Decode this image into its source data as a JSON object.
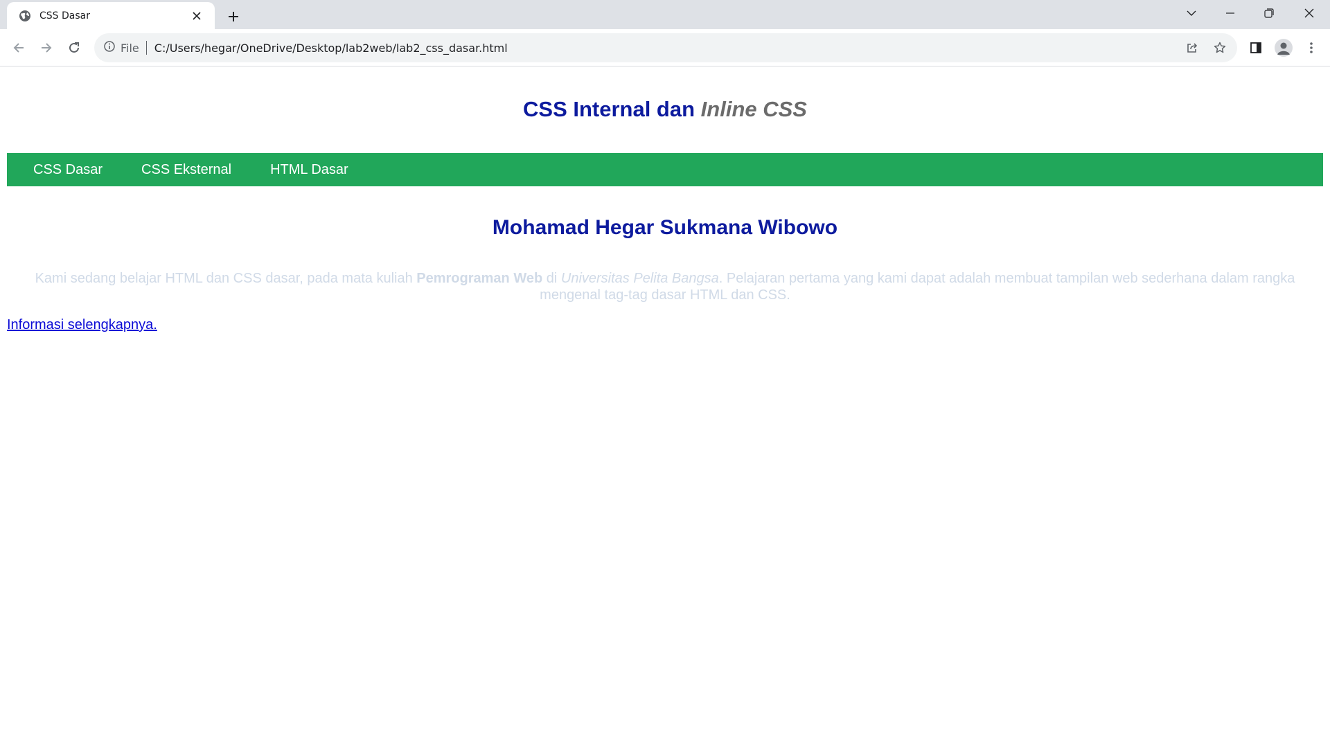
{
  "browser": {
    "tab_title": "CSS Dasar",
    "address_scheme_label": "File",
    "url": "C:/Users/hegar/OneDrive/Desktop/lab2web/lab2_css_dasar.html"
  },
  "page": {
    "title_main": "CSS Internal dan ",
    "title_emphasis": "Inline CSS",
    "nav": [
      {
        "label": "CSS Dasar"
      },
      {
        "label": "CSS Eksternal"
      },
      {
        "label": "HTML Dasar"
      }
    ],
    "author": "Mohamad Hegar Sukmana Wibowo",
    "paragraph": {
      "part1": "Kami sedang belajar HTML dan CSS dasar, pada mata kuliah ",
      "bold": "Pemrograman Web",
      "part2": " di ",
      "italic": "Universitas Pelita Bangsa",
      "part3": ". Pelajaran pertama yang kami dapat adalah membuat tampilan web sederhana dalam rangka mengenal tag-tag dasar HTML dan CSS."
    },
    "more_link": "Informasi selengkapnya."
  },
  "colors": {
    "heading": "#0d1b9e",
    "heading_emphasis": "#6b6b6b",
    "navbar": "#21a75a",
    "paragraph": "#d0dae7",
    "link": "#0b0bd6"
  }
}
